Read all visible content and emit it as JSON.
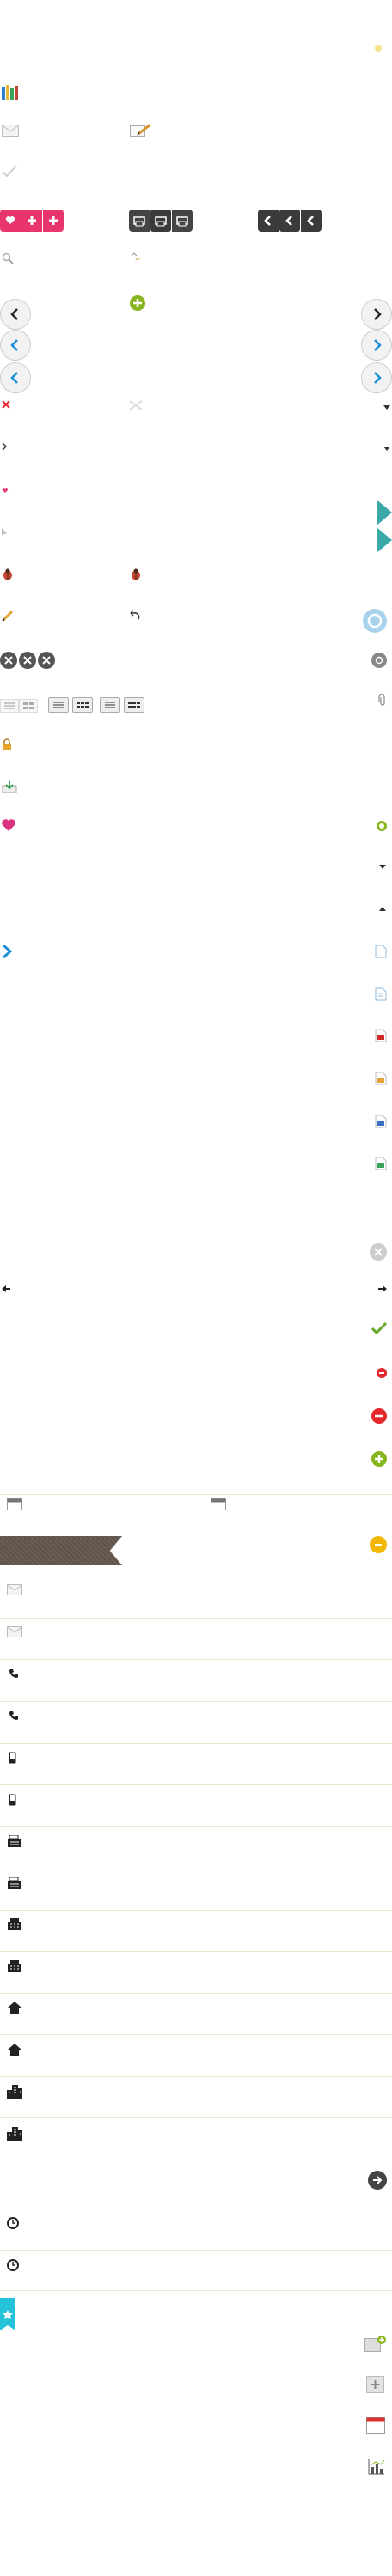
{
  "sprite": {
    "title": "",
    "colors": {
      "pink": "#e8356d",
      "dark": "#3a3a3a",
      "green": "#86b51d",
      "blue": "#1d8fd8",
      "cyan": "#25c3d9",
      "red": "#e5262b",
      "gold": "#f2b705",
      "line": "#e9e6cf"
    }
  },
  "icons": [
    {
      "name": "calendar-star-icon"
    },
    {
      "name": "books-icon"
    },
    {
      "name": "mail-icon"
    },
    {
      "name": "edit-icon"
    },
    {
      "name": "check-icon"
    },
    {
      "name": "search-icon"
    },
    {
      "name": "ribbon-icon"
    },
    {
      "name": "lock-icon"
    },
    {
      "name": "heart-icon"
    },
    {
      "name": "bug-icon"
    },
    {
      "name": "pencil-icon"
    },
    {
      "name": "undo-icon"
    },
    {
      "name": "phone-icon"
    },
    {
      "name": "mobile-icon"
    },
    {
      "name": "fax-icon"
    },
    {
      "name": "building-icon"
    },
    {
      "name": "home-icon"
    },
    {
      "name": "city-icon"
    },
    {
      "name": "clock-icon"
    },
    {
      "name": "bookmark-icon"
    },
    {
      "name": "file-icon"
    },
    {
      "name": "calendar-icon"
    }
  ]
}
